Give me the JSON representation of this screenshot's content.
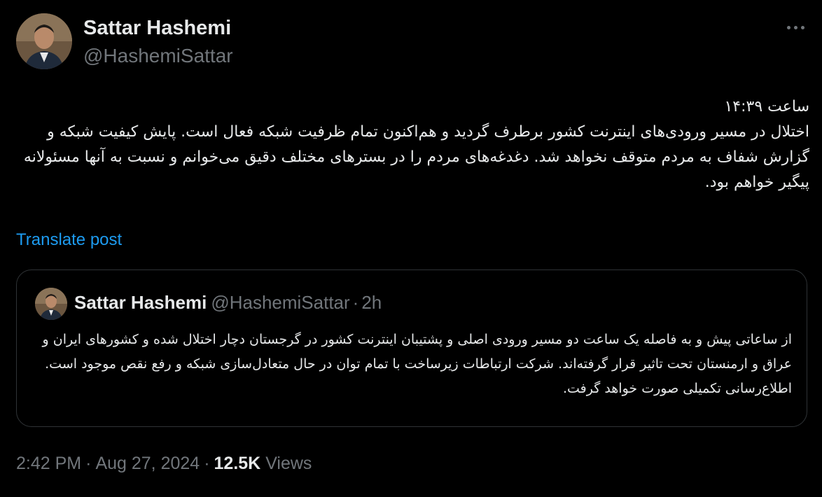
{
  "author": {
    "name": "Sattar Hashemi",
    "handle": "@HashemiSattar"
  },
  "tweet": {
    "lines": [
      "ساعت ۱۴:۳۹",
      "اختلال در مسیر ورودی‌های اینترنت کشور برطرف گردید و هم‌اکنون تمام ظرفیت شبکه فعال است. پایش کیفیت شبکه و گزارش شفاف به مردم متوقف نخواهد شد. دغدغه‌های مردم را در بسترهای مختلف دقیق می‌خوانم و نسبت به آنها مسئولانه پیگیر خواهم بود."
    ],
    "translate_label": "Translate post"
  },
  "quote": {
    "name": "Sattar Hashemi",
    "handle": "@HashemiSattar",
    "dot": "·",
    "time": "2h",
    "text": "از ساعاتی پیش و به فاصله یک ساعت دو مسیر ورودی اصلی و پشتیبان اینترنت کشور در گرجستان دچار اختلال شده و کشورهای ایران و عراق و ارمنستان تحت تاثیر قرار گرفته‌اند. شرکت ارتباطات زیرساخت با تمام توان در حال متعادل‌سازی شبکه و رفع نقص موجود است.  اطلاع‌رسانی تکمیلی صورت خواهد گرفت."
  },
  "meta": {
    "time": "2:42 PM",
    "date": "Aug 27, 2024",
    "separator": "·",
    "views_count": "12.5K",
    "views_label": "Views"
  },
  "icons": {
    "more": "more-horizontal-icon"
  },
  "colors": {
    "background": "#000000",
    "primary_text": "#e7e9ea",
    "secondary_text": "#71767b",
    "link": "#1d9bf0",
    "border": "#2f3336"
  }
}
